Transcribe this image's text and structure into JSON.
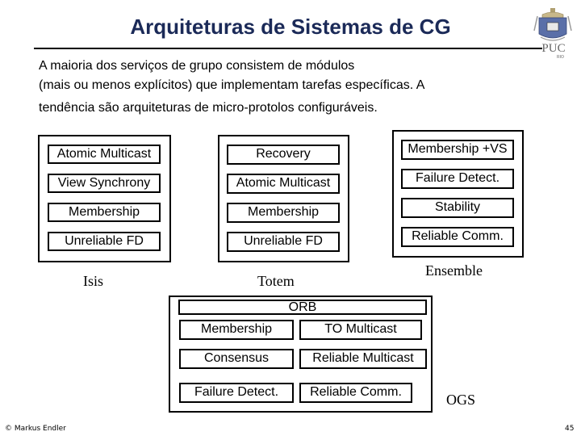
{
  "slide": {
    "title": "Arquiteturas de Sistemas de CG",
    "logo": {
      "icon": "puc-rio-crest-icon",
      "text": "PUC",
      "subtext": "RIO"
    },
    "intro_lines": [
      "A maioria dos serviços de grupo consistem de módulos",
      "(mais ou menos explícitos) que implementam tarefas específicas. A",
      "tendência são arquiteturas de micro-protolos configuráveis."
    ],
    "footer": {
      "author": "© Markus Endler",
      "page_number": "45"
    }
  },
  "stacks": {
    "isis": {
      "label": "Isis",
      "modules": [
        "Atomic Multicast",
        "View Synchrony",
        "Membership",
        "Unreliable FD"
      ]
    },
    "totem": {
      "label": "Totem",
      "modules": [
        "Recovery",
        "Atomic Multicast",
        "Membership",
        "Unreliable FD"
      ]
    },
    "ensemble": {
      "label": "Ensemble",
      "modules": [
        "Membership +VS",
        "Failure Detect.",
        "Stability",
        "Reliable Comm."
      ]
    },
    "ogs": {
      "label": "OGS",
      "top_module": "ORB",
      "left_modules": [
        "Membership",
        "Consensus",
        "Failure Detect."
      ],
      "right_modules": [
        "TO Multicast",
        "Reliable Multicast",
        "Reliable Comm."
      ]
    }
  }
}
